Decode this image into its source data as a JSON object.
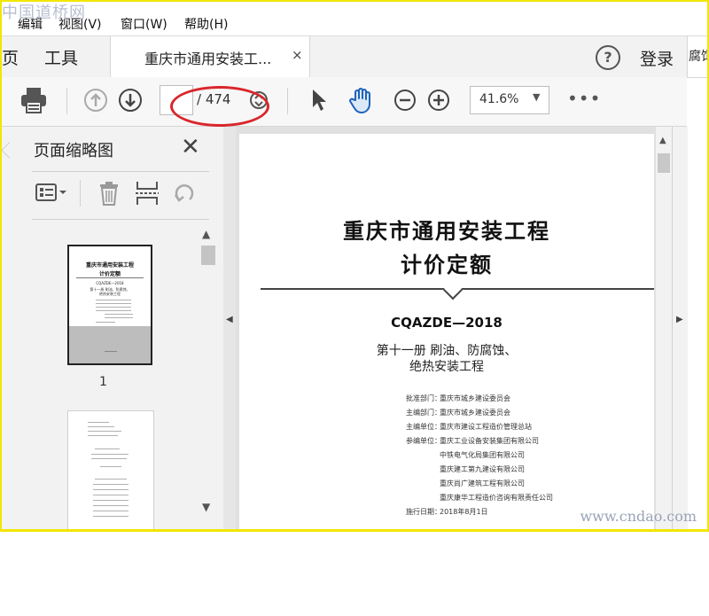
{
  "watermarks": {
    "top": "中国道桥网",
    "bottom": "www.cndao.com"
  },
  "menu": {
    "items": [
      "编辑",
      "视图(V)",
      "窗口(W)",
      "帮助(H)"
    ]
  },
  "tabbar": {
    "nav_items": [
      "页",
      "工具"
    ],
    "document_tab": {
      "title": "重庆市通用安装工...",
      "close": "×"
    },
    "help": "?",
    "login": "登录",
    "right_partial": "腐饵"
  },
  "toolbar": {
    "page_current": "",
    "page_total": "/ 474",
    "zoom": "41.6%",
    "more": "•••"
  },
  "thumbnails_panel": {
    "title": "页面缩略图",
    "pages": [
      {
        "label": "1",
        "title_lines": [
          "重庆市通用安装工程",
          "计价定额"
        ],
        "code": "CQAZDE—2018",
        "sub": [
          "第十一册 刷油、防腐蚀、",
          "绝热安装工程"
        ]
      }
    ]
  },
  "document": {
    "title_lines": [
      "重庆市通用安装工程",
      "计价定额"
    ],
    "code": "CQAZDE—2018",
    "volume_lines": [
      "第十一册  刷油、防腐蚀、",
      "绝热安装工程"
    ],
    "rows": [
      {
        "label": "批准部门：",
        "value": "重庆市城乡建设委员会"
      },
      {
        "label": "主编部门：",
        "value": "重庆市城乡建设委员会"
      },
      {
        "label": "主编单位：",
        "value": "重庆市建设工程造价管理总站"
      },
      {
        "label": "参编单位：",
        "value": "重庆工业设备安装集团有限公司"
      },
      {
        "label": "",
        "value": "中铁电气化局集团有限公司"
      },
      {
        "label": "",
        "value": "重庆建工第九建设有限公司"
      },
      {
        "label": "",
        "value": "重庆尚广建筑工程有限公司"
      },
      {
        "label": "",
        "value": "重庆康华工程造价咨询有限责任公司"
      },
      {
        "label": "施行日期：",
        "value": "2018年8月1日"
      }
    ]
  }
}
